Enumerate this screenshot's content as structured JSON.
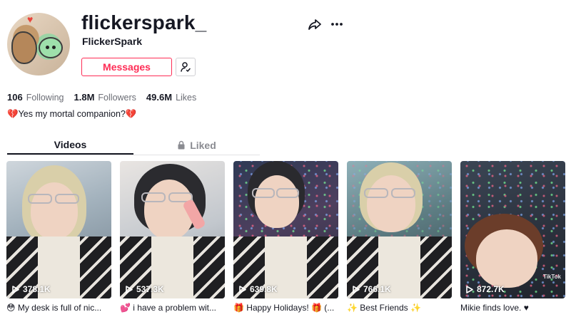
{
  "profile": {
    "username": "flickerspark_",
    "display_name": "FlickerSpark",
    "messages_label": "Messages",
    "bio": "Yes my mortal companion?",
    "bio_emoji_left": "💔",
    "bio_emoji_right": "💔"
  },
  "stats": [
    {
      "value": "106",
      "label": "Following"
    },
    {
      "value": "1.8M",
      "label": "Followers"
    },
    {
      "value": "49.6M",
      "label": "Likes"
    }
  ],
  "tabs": {
    "videos": "Videos",
    "liked": "Liked"
  },
  "icons": {
    "share": "share-icon",
    "more": "more-icon",
    "follow": "user-follow-icon",
    "lock": "lock-icon",
    "play": "play-icon"
  },
  "colors": {
    "accent": "#fe2c55",
    "text": "#161823",
    "muted": "#8a8b91"
  },
  "videos": [
    {
      "views": "378.1K",
      "caption": "😳 My desk is full of nic..."
    },
    {
      "views": "537.3K",
      "caption": "💕 i have a problem wit..."
    },
    {
      "views": "639.8K",
      "caption": "🎁 Happy Holidays! 🎁 (..."
    },
    {
      "views": "766.1K",
      "caption": "✨ Best Friends ✨"
    },
    {
      "views": "872.7K",
      "caption": "Mikie finds love. ♥",
      "watermark": "TikTok"
    }
  ]
}
